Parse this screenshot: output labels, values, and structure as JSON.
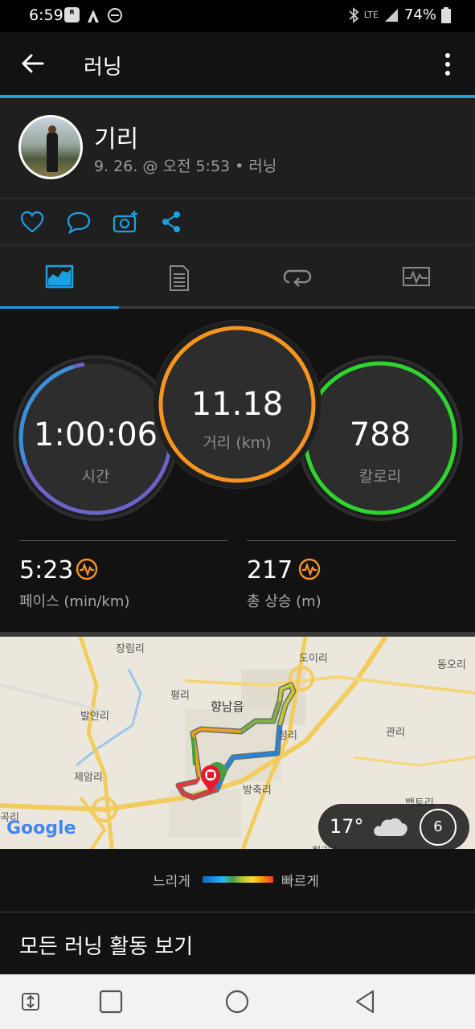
{
  "status": {
    "time": "6:59",
    "battery": "74%",
    "network": "LTE"
  },
  "appbar": {
    "title": "러닝"
  },
  "activity": {
    "user": "기리",
    "meta": "9. 26. @ 오전 5:53 • 러닝"
  },
  "rings": {
    "time": {
      "value": "1:00:06",
      "label": "시간"
    },
    "distance": {
      "value": "11.18",
      "label": "거리 (km)"
    },
    "calories": {
      "value": "788",
      "label": "칼로리"
    }
  },
  "substats": {
    "pace": {
      "value": "5:23",
      "label": "페이스 (min/km)"
    },
    "elevation": {
      "value": "217",
      "label": "총 상승 (m)"
    }
  },
  "map": {
    "labels": [
      "장림리",
      "도이리",
      "동오리",
      "평리",
      "향남읍",
      "발안리",
      "정리",
      "관리",
      "제암리",
      "방축리",
      "백토리",
      "곡리",
      "화리리"
    ],
    "weather": {
      "temp": "17°",
      "wind": "6"
    },
    "attribution": "Google"
  },
  "legend": {
    "slow": "느리게",
    "fast": "빠르게"
  },
  "footer": {
    "all_runs": "모든 러닝 활동 보기"
  },
  "colors": {
    "accent": "#1ba1e2",
    "time_ring": "#6a63c9",
    "distance_ring": "#f7941d",
    "calorie_ring": "#2ed52e"
  }
}
